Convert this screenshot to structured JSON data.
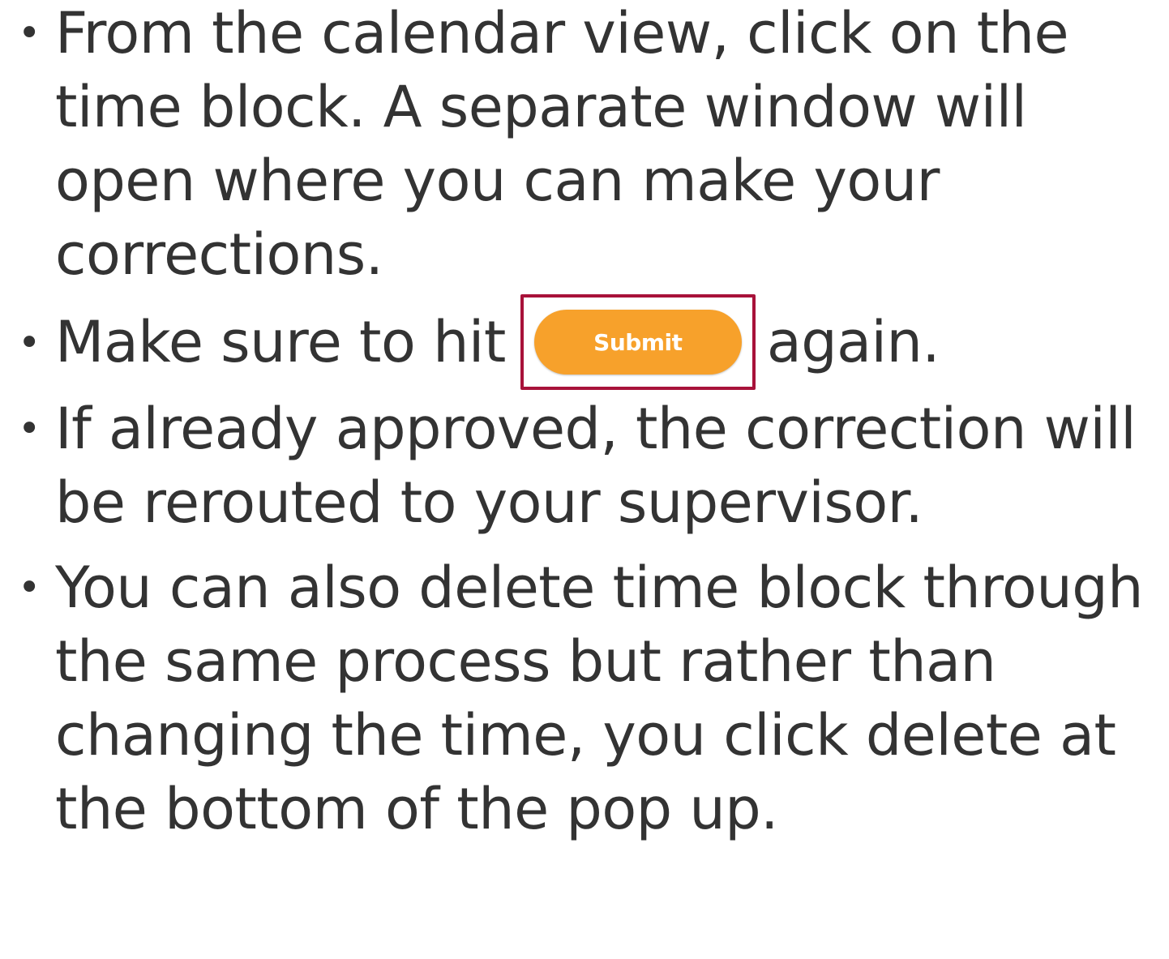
{
  "bullets": [
    {
      "text": "From the calendar view, click on the time block. A separate window will open where you can make your corrections."
    },
    {
      "text_before": "Make sure to hit",
      "button_label": "Submit",
      "text_after": "again."
    },
    {
      "text": "If already approved, the correction will be rerouted to your supervisor."
    },
    {
      "text": "You can also delete time block through the same process but rather than changing the time, you click delete at the bottom of the pop up."
    }
  ],
  "colors": {
    "text": "#333333",
    "button_fill": "#f7a12b",
    "highlight_border": "#a8123a"
  },
  "icons": {
    "bullet_marker": "bullet-dot-icon"
  }
}
